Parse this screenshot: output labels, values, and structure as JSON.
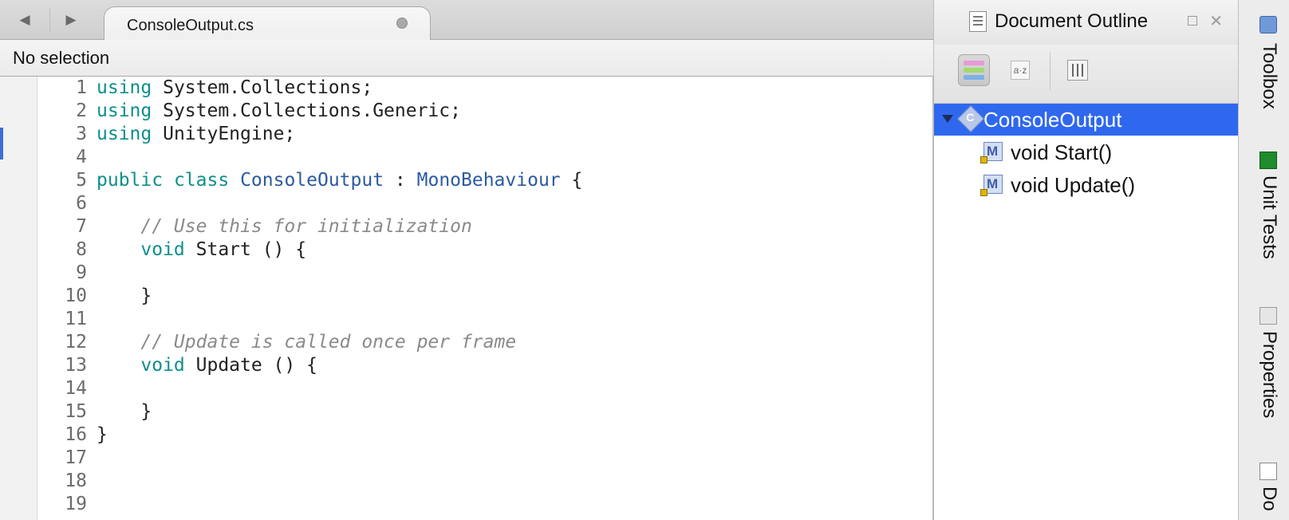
{
  "editor": {
    "tab_title": "ConsoleOutput.cs",
    "path_label": "No selection",
    "lines": [
      {
        "n": "1",
        "parts": [
          {
            "t": "using",
            "c": "kw"
          },
          {
            "t": " System.Collections;",
            "c": "pl"
          }
        ]
      },
      {
        "n": "2",
        "parts": [
          {
            "t": "using",
            "c": "kw"
          },
          {
            "t": " System.Collections.Generic;",
            "c": "pl"
          }
        ]
      },
      {
        "n": "3",
        "parts": [
          {
            "t": "using",
            "c": "kw"
          },
          {
            "t": " UnityEngine;",
            "c": "pl"
          }
        ]
      },
      {
        "n": "4",
        "parts": []
      },
      {
        "n": "5",
        "parts": [
          {
            "t": "public",
            "c": "kw"
          },
          {
            "t": " ",
            "c": "pl"
          },
          {
            "t": "class",
            "c": "kw"
          },
          {
            "t": " ",
            "c": "pl"
          },
          {
            "t": "ConsoleOutput",
            "c": "ty"
          },
          {
            "t": " : ",
            "c": "pl"
          },
          {
            "t": "MonoBehaviour",
            "c": "ty"
          },
          {
            "t": " {",
            "c": "pl"
          }
        ]
      },
      {
        "n": "6",
        "parts": []
      },
      {
        "n": "7",
        "parts": [
          {
            "t": "    // Use this for initialization",
            "c": "cm"
          }
        ]
      },
      {
        "n": "8",
        "parts": [
          {
            "t": "    ",
            "c": "pl"
          },
          {
            "t": "void",
            "c": "kw"
          },
          {
            "t": " Start () {",
            "c": "pl"
          }
        ]
      },
      {
        "n": "9",
        "parts": []
      },
      {
        "n": "10",
        "parts": [
          {
            "t": "    }",
            "c": "pl"
          }
        ]
      },
      {
        "n": "11",
        "parts": []
      },
      {
        "n": "12",
        "parts": [
          {
            "t": "    // Update is called once per frame",
            "c": "cm"
          }
        ]
      },
      {
        "n": "13",
        "parts": [
          {
            "t": "    ",
            "c": "pl"
          },
          {
            "t": "void",
            "c": "kw"
          },
          {
            "t": " Update () {",
            "c": "pl"
          }
        ]
      },
      {
        "n": "14",
        "parts": []
      },
      {
        "n": "15",
        "parts": [
          {
            "t": "    }",
            "c": "pl"
          }
        ]
      },
      {
        "n": "16",
        "parts": [
          {
            "t": "}",
            "c": "pl"
          }
        ]
      },
      {
        "n": "17",
        "parts": []
      },
      {
        "n": "18",
        "parts": []
      },
      {
        "n": "19",
        "parts": []
      }
    ]
  },
  "outline": {
    "title": "Document Outline",
    "class_name": "ConsoleOutput",
    "class_icon_letter": "C",
    "method_icon_letter": "M",
    "az_label": "a·z",
    "methods": [
      "void Start()",
      "void Update()"
    ]
  },
  "dock": {
    "items": [
      "Toolbox",
      "Unit Tests",
      "Properties",
      "Do"
    ]
  },
  "colors": {
    "keyword": "#0e8f8a",
    "type": "#2c5aa0",
    "comment": "#8a8a8a",
    "selection": "#2f68ef"
  }
}
